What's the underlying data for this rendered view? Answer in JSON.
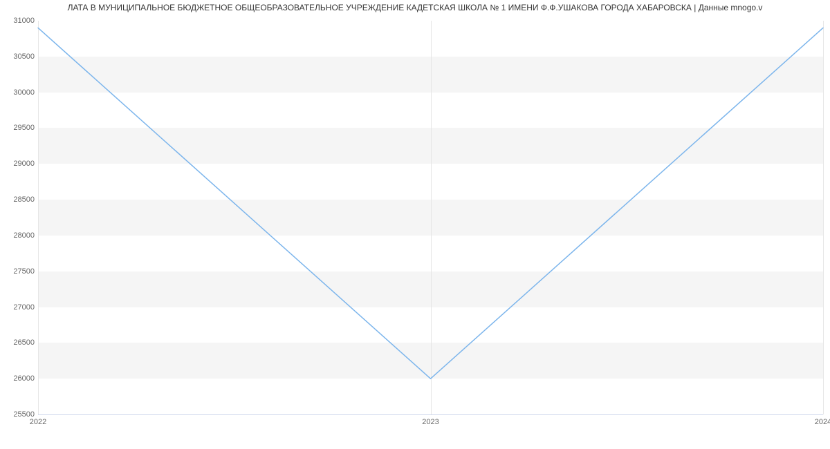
{
  "chart_data": {
    "type": "line",
    "title": "ЛАТА В МУНИЦИПАЛЬНОЕ БЮДЖЕТНОЕ ОБЩЕОБРАЗОВАТЕЛЬНОЕ УЧРЕЖДЕНИЕ КАДЕТСКАЯ ШКОЛА № 1 ИМЕНИ Ф.Ф.УШАКОВА ГОРОДА ХАБАРОВСКА | Данные mnogo.v",
    "x": [
      2022,
      2023,
      2024
    ],
    "values": [
      30900,
      26000,
      30900
    ],
    "xlabel": "",
    "ylabel": "",
    "xlim": [
      2022,
      2024
    ],
    "ylim": [
      25500,
      31000
    ],
    "x_ticks": [
      2022,
      2023,
      2024
    ],
    "y_ticks": [
      25500,
      26000,
      26500,
      27000,
      27500,
      28000,
      28500,
      29000,
      29500,
      30000,
      30500,
      31000
    ],
    "line_color": "#7cb5ec"
  }
}
